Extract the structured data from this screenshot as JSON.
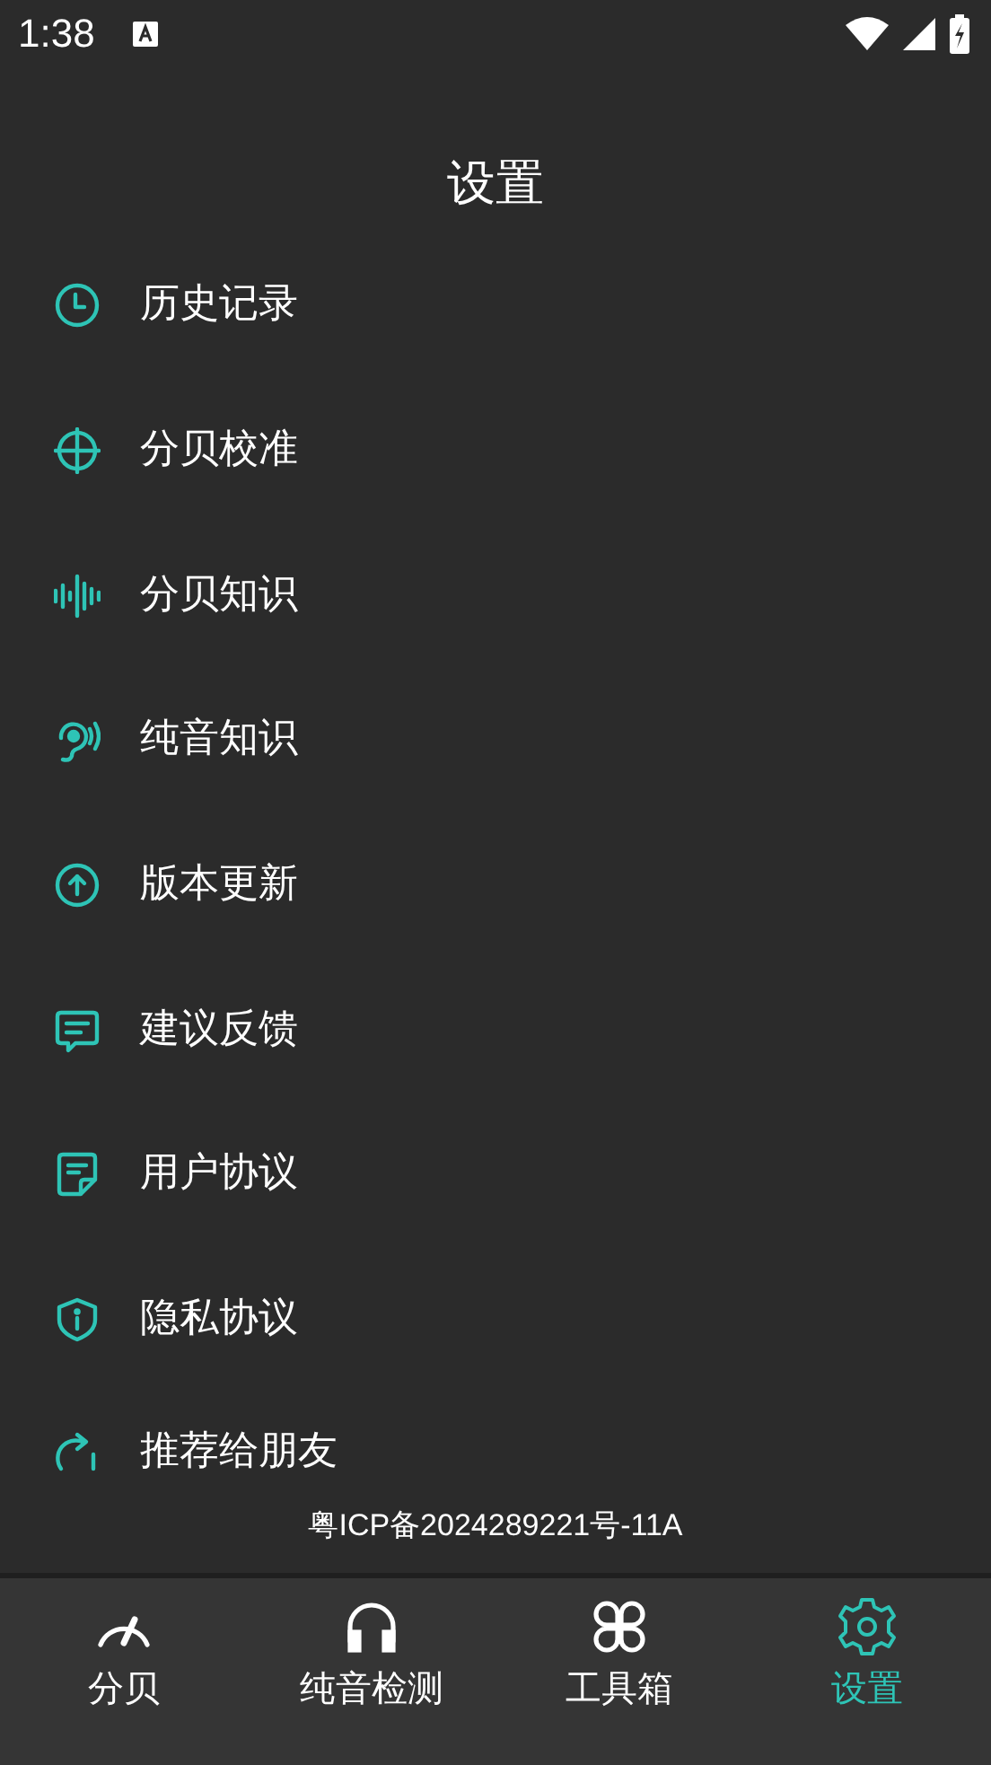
{
  "status_bar": {
    "time": "1:38"
  },
  "title": "设置",
  "menu": [
    {
      "label": "历史记录"
    },
    {
      "label": "分贝校准"
    },
    {
      "label": "分贝知识"
    },
    {
      "label": "纯音知识"
    },
    {
      "label": "版本更新"
    },
    {
      "label": "建议反馈"
    },
    {
      "label": "用户协议"
    },
    {
      "label": "隐私协议"
    },
    {
      "label": "推荐给朋友"
    }
  ],
  "footer": "粤ICP备2024289221号-11A",
  "tabs": [
    {
      "label": "分贝",
      "selected": false
    },
    {
      "label": "纯音检测",
      "selected": false
    },
    {
      "label": "工具箱",
      "selected": false
    },
    {
      "label": "设置",
      "selected": true
    }
  ]
}
